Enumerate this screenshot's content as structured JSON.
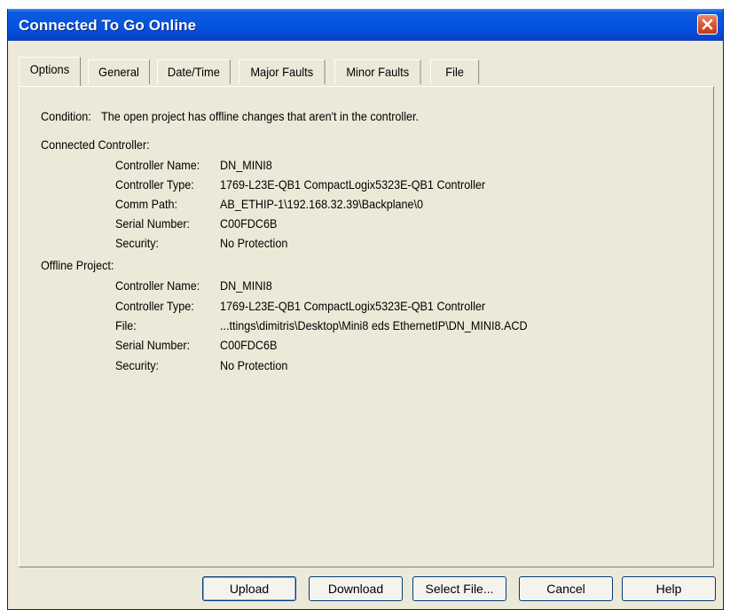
{
  "window": {
    "title": "Connected To Go Online"
  },
  "tabs": [
    {
      "label": "Options",
      "active": true
    },
    {
      "label": "General",
      "active": false
    },
    {
      "label": "Date/Time",
      "active": false
    },
    {
      "label": "Major Faults",
      "active": false
    },
    {
      "label": "Minor Faults",
      "active": false
    },
    {
      "label": "File",
      "active": false
    }
  ],
  "condition": {
    "label": "Condition:",
    "text": "The open project has offline changes that aren't in the controller."
  },
  "connected": {
    "heading": "Connected Controller:",
    "rows": [
      {
        "label": "Controller Name:",
        "value": "DN_MINI8"
      },
      {
        "label": "Controller Type:",
        "value": "1769-L23E-QB1 CompactLogix5323E-QB1 Controller"
      },
      {
        "label": "Comm Path:",
        "value": "AB_ETHIP-1\\192.168.32.39\\Backplane\\0"
      },
      {
        "label": "Serial Number:",
        "value": "C00FDC6B"
      },
      {
        "label": "Security:",
        "value": "No Protection"
      }
    ]
  },
  "offline": {
    "heading": "Offline Project:",
    "rows": [
      {
        "label": "Controller Name:",
        "value": "DN_MINI8"
      },
      {
        "label": "Controller Type:",
        "value": "1769-L23E-QB1 CompactLogix5323E-QB1 Controller"
      },
      {
        "label": "File:",
        "value": "...ttings\\dimitris\\Desktop\\Mini8 eds EthernetIP\\DN_MINI8.ACD"
      },
      {
        "label": "Serial Number:",
        "value": "C00FDC6B"
      },
      {
        "label": "Security:",
        "value": "No Protection"
      }
    ]
  },
  "buttons": {
    "upload": "Upload",
    "download": "Download",
    "select_file": "Select File...",
    "cancel": "Cancel",
    "help": "Help"
  },
  "icons": {
    "close": "close-icon"
  },
  "colors": {
    "titlebar": "#0654e0",
    "face": "#ece9d8",
    "close": "#d8532b"
  }
}
